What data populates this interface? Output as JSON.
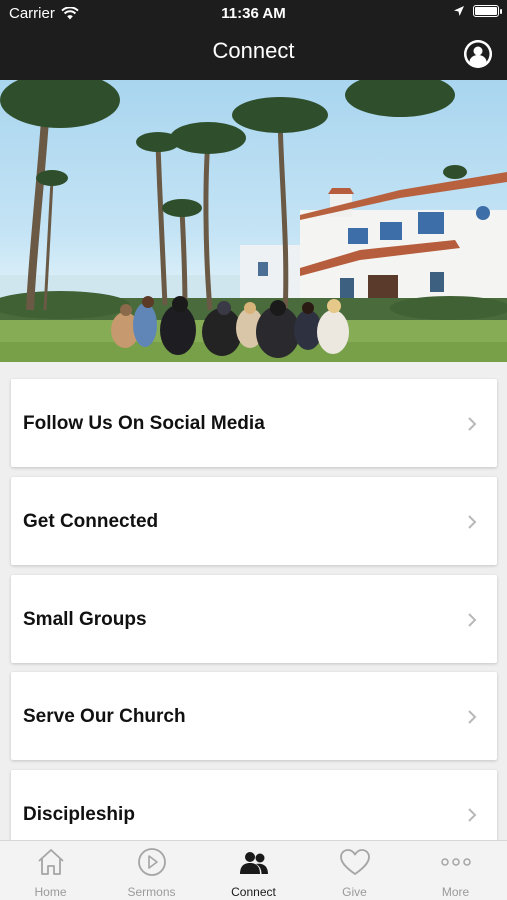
{
  "status_bar": {
    "carrier": "Carrier",
    "time": "11:36 AM"
  },
  "nav": {
    "title": "Connect"
  },
  "hero": {
    "icon": "photo"
  },
  "menu": [
    {
      "label": "Follow Us On Social Media"
    },
    {
      "label": "Get Connected"
    },
    {
      "label": "Small Groups"
    },
    {
      "label": "Serve Our Church"
    },
    {
      "label": "Discipleship"
    }
  ],
  "tabs": [
    {
      "label": "Home",
      "icon": "home-icon",
      "active": false
    },
    {
      "label": "Sermons",
      "icon": "play-icon",
      "active": false
    },
    {
      "label": "Connect",
      "icon": "people-icon",
      "active": true
    },
    {
      "label": "Give",
      "icon": "heart-icon",
      "active": false
    },
    {
      "label": "More",
      "icon": "more-icon",
      "active": false
    }
  ],
  "colors": {
    "bar": "#1d1d1d",
    "background": "#efefef",
    "tab_inactive": "#9a9a9a",
    "tab_active": "#1a1a1a"
  }
}
